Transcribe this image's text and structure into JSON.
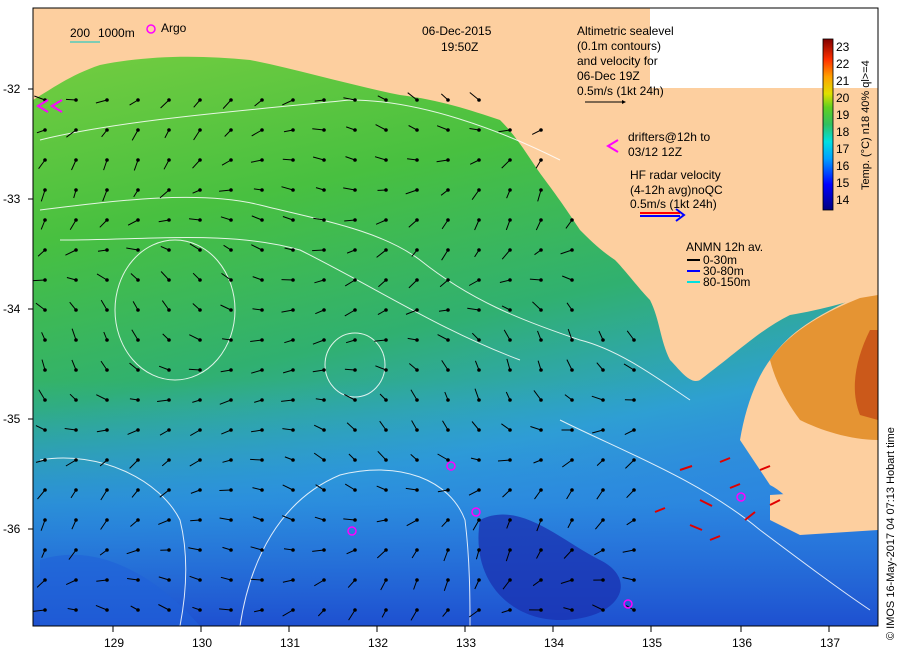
{
  "header": {
    "date": "06-Dec-2015",
    "time": "19:50Z"
  },
  "legend": {
    "depth_200": "200",
    "depth_1000": "1000m",
    "argo": "Argo",
    "altimetry": [
      "Altimetric sealevel",
      "(0.1m contours)",
      "and velocity for",
      "06-Dec 19Z",
      "0.5m/s (1kt 24h)"
    ],
    "drifters": [
      "drifters@12h to",
      "03/12 12Z"
    ],
    "hf_radar": [
      "HF radar velocity",
      "(4-12h avg)noQC",
      "0.5m/s (1kt 24h)"
    ],
    "anmn": [
      "ANMN 12h av.",
      "0-30m",
      "30-80m",
      "80-150m"
    ],
    "anmn_colors": [
      "#000000",
      "#0000ff",
      "#00ffff"
    ]
  },
  "colorbar": {
    "label": "Temp. (°C) n18 40% ql>=4",
    "ticks": [
      "23",
      "22",
      "21",
      "20",
      "19",
      "18",
      "17",
      "16",
      "15",
      "14"
    ]
  },
  "axes": {
    "x_ticks": [
      "129",
      "130",
      "131",
      "132",
      "133",
      "134",
      "135",
      "136",
      "137"
    ],
    "y_ticks": [
      "-32",
      "-33",
      "-34",
      "-35",
      "-36"
    ]
  },
  "credit": "© IMOS 16-May-2017 04 07:13 Hobart time",
  "colors": {
    "land": "#fdcf9f",
    "sst_green": "#3fbf3f",
    "sst_blue": "#2f9fdf",
    "argo": "#ff00ff",
    "hf_red": "#ff0000"
  }
}
